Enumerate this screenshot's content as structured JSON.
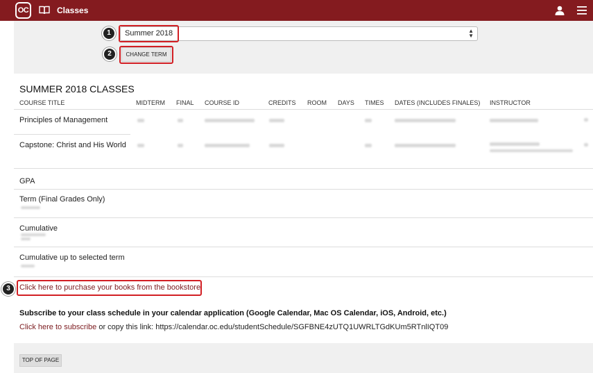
{
  "header": {
    "logo_text": "OC",
    "title": "Classes",
    "icons": [
      "book-icon",
      "user-icon",
      "menu-icon"
    ],
    "bar_color": "#841b1f"
  },
  "term": {
    "selected": "Summer 2018",
    "change_button": "CHANGE TERM"
  },
  "callouts": [
    "1",
    "2",
    "3"
  ],
  "classes": {
    "title": "SUMMER 2018 CLASSES",
    "columns": [
      "COURSE TITLE",
      "MIDTERM",
      "FINAL",
      "COURSE ID",
      "CREDITS",
      "ROOM",
      "DAYS",
      "TIMES",
      "DATES (INCLUDES FINALES)",
      "INSTRUCTOR"
    ],
    "rows": [
      {
        "title": "Principles of Management"
      },
      {
        "title": "Capstone: Christ and His World"
      }
    ]
  },
  "gpa": {
    "heading": "GPA",
    "term_label": "Term (Final Grades Only)",
    "cumulative_label": "Cumulative",
    "cumulative_up_label": "Cumulative up to selected term"
  },
  "links": {
    "bookstore": "Click here to purchase your books from the bookstore",
    "subscribe_heading": "Subscribe to your class schedule in your calendar application (Google Calendar, Mac OS Calendar, iOS, Android, etc.)",
    "subscribe_link": "Click here to subscribe",
    "copy_text": " or copy this link: ",
    "calendar_url": "https://calendar.oc.edu/studentSchedule/SGFBNE4zUTQ1UWRLTGdKUm5RTnlIQT09"
  },
  "footer": {
    "top_button": "TOP OF PAGE"
  }
}
